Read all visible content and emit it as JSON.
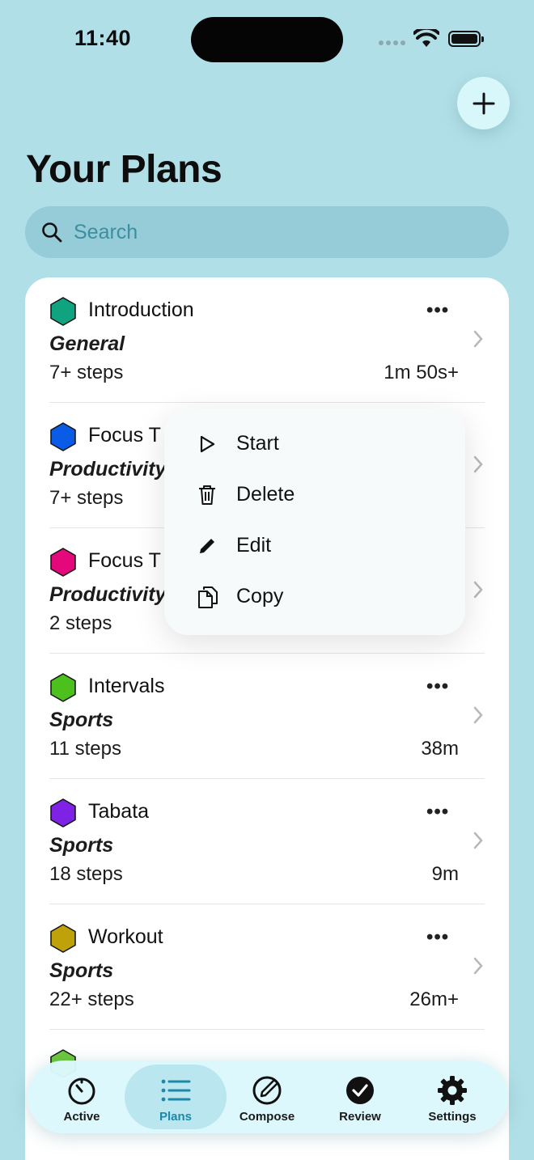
{
  "status_bar": {
    "time": "11:40"
  },
  "header": {
    "title": "Your Plans"
  },
  "search": {
    "placeholder": "Search"
  },
  "plans": [
    {
      "name": "Introduction",
      "category": "General",
      "steps": "7+ steps",
      "duration": "1m 50s+",
      "color": "#10a37f"
    },
    {
      "name": "Focus T",
      "category": "Productivity",
      "steps": "7+ steps",
      "duration": "",
      "color": "#0a5ce6"
    },
    {
      "name": "Focus T",
      "category": "Productivity",
      "steps": "2 steps",
      "duration": "",
      "color": "#e4087a"
    },
    {
      "name": "Intervals",
      "category": "Sports",
      "steps": "11 steps",
      "duration": "38m",
      "color": "#4cc01c"
    },
    {
      "name": "Tabata",
      "category": "Sports",
      "steps": "18 steps",
      "duration": "9m",
      "color": "#7e22e6"
    },
    {
      "name": "Workout",
      "category": "Sports",
      "steps": "22+ steps",
      "duration": "26m+",
      "color": "#bfa20a"
    },
    {
      "name": "",
      "category": "",
      "steps": "",
      "duration": "",
      "color": "#6cc83c"
    }
  ],
  "context_menu": {
    "items": [
      {
        "label": "Start",
        "icon": "play-icon"
      },
      {
        "label": "Delete",
        "icon": "trash-icon"
      },
      {
        "label": "Edit",
        "icon": "pencil-icon"
      },
      {
        "label": "Copy",
        "icon": "copy-icon"
      }
    ]
  },
  "tab_bar": {
    "tabs": [
      {
        "label": "Active",
        "icon": "timer-icon"
      },
      {
        "label": "Plans",
        "icon": "list-icon"
      },
      {
        "label": "Compose",
        "icon": "compose-icon"
      },
      {
        "label": "Review",
        "icon": "checkmark-circle-icon"
      },
      {
        "label": "Settings",
        "icon": "gear-icon"
      }
    ],
    "selected": "Plans"
  },
  "colors": {
    "background": "#b1dfe7",
    "accent": "#1e88a8"
  }
}
